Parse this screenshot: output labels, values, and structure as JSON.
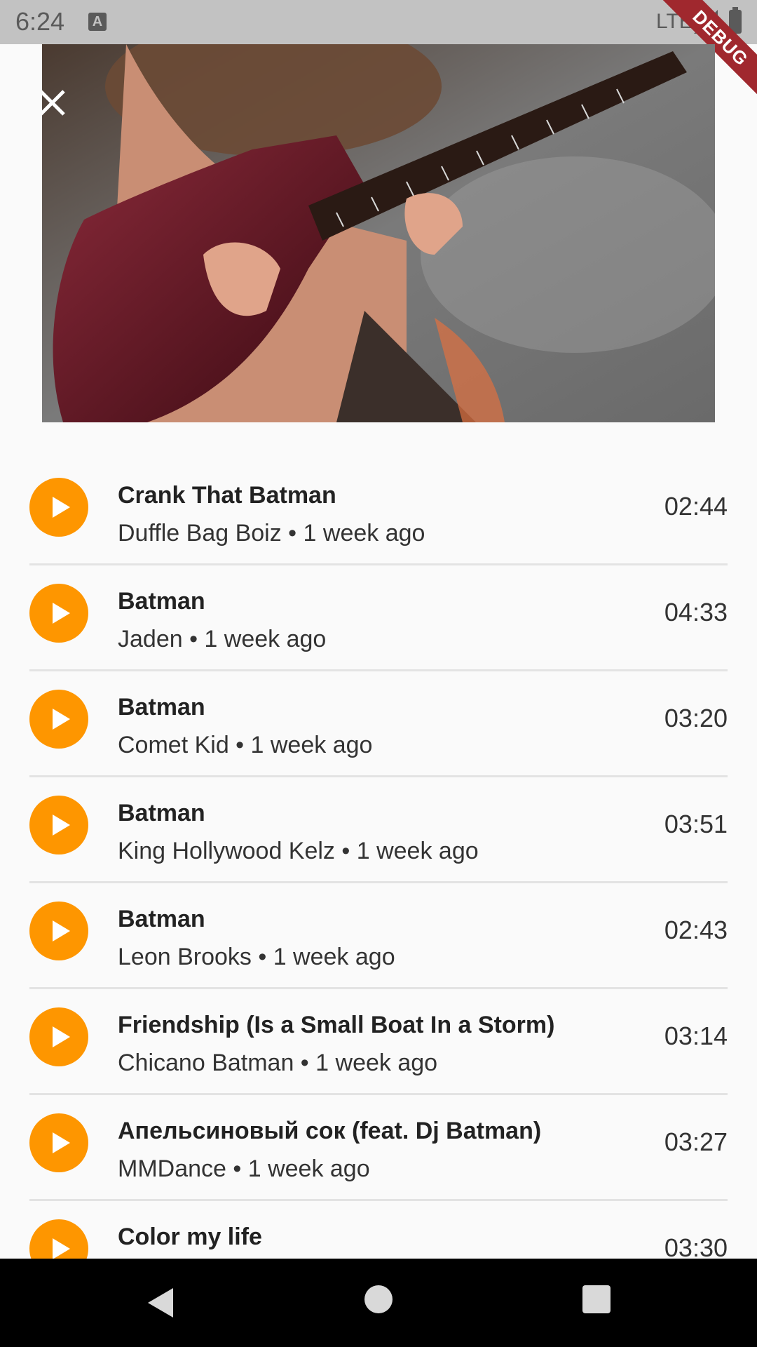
{
  "status_bar": {
    "time": "6:24",
    "notification_icon": "A",
    "network": "LTE",
    "signal_icon": "signal-icon",
    "battery_icon": "battery-icon"
  },
  "debug_banner": "DEBUG",
  "video": {
    "close_icon": "close-icon",
    "description": "guitar-video-thumbnail"
  },
  "tracks": [
    {
      "title": "Crank That Batman",
      "subtitle": "Duffle Bag Boiz • 1 week ago",
      "duration": "02:44"
    },
    {
      "title": "Batman",
      "subtitle": "Jaden • 1 week ago",
      "duration": "04:33"
    },
    {
      "title": "Batman",
      "subtitle": "Comet Kid • 1 week ago",
      "duration": "03:20"
    },
    {
      "title": "Batman",
      "subtitle": "King Hollywood Kelz • 1 week ago",
      "duration": "03:51"
    },
    {
      "title": "Batman",
      "subtitle": "Leon Brooks • 1 week ago",
      "duration": "02:43"
    },
    {
      "title": "Friendship (Is a Small Boat In a Storm)",
      "subtitle": "Chicano Batman • 1 week ago",
      "duration": "03:14"
    },
    {
      "title": "Апельсиновый сок (feat. Dj Batman)",
      "subtitle": "MMDance • 1 week ago",
      "duration": "03:27"
    },
    {
      "title": "Color my life",
      "subtitle": "",
      "duration": "03:30"
    }
  ],
  "colors": {
    "accent": "#fe9600",
    "background": "#fafafa",
    "status_bar": "#c2c2c2",
    "nav_bar": "#000000"
  },
  "nav": {
    "back_icon": "back-icon",
    "home_icon": "home-icon",
    "recents_icon": "recents-icon"
  }
}
